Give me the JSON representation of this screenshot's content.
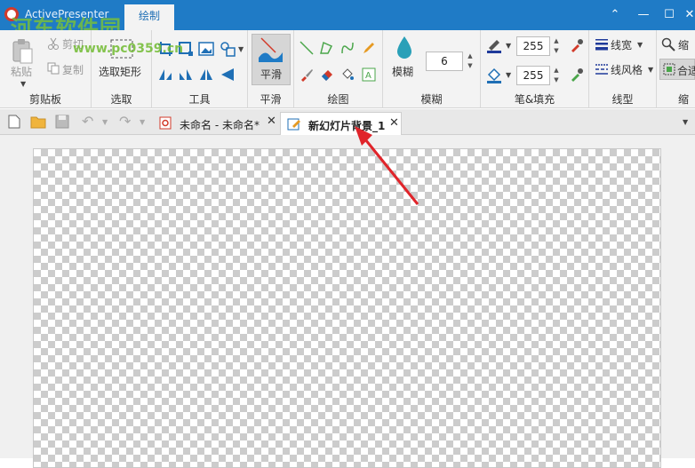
{
  "window": {
    "app_title": "ActivePresenter",
    "active_ribbon_tab": "绘制",
    "watermark_main": "河东软件园",
    "watermark_sub": "www.pc0359.cn",
    "controls": {
      "ribbon_toggle": "⌃",
      "minimize": "—",
      "maximize": "☐",
      "close": "✕"
    }
  },
  "ribbon": {
    "clipboard": {
      "label": "剪贴板",
      "paste": "粘贴",
      "cut": "剪切",
      "copy": "复制"
    },
    "select": {
      "label": "选取",
      "select_rect": "选取矩形"
    },
    "tools": {
      "label": "工具"
    },
    "smooth": {
      "label": "平滑",
      "smooth_button": "平滑"
    },
    "draw": {
      "label": "绘图"
    },
    "blur": {
      "label": "模糊",
      "blur_button": "模糊",
      "blur_value": "6"
    },
    "pen_fill": {
      "label": "笔&填充",
      "pen_value": "255",
      "fill_value": "255"
    },
    "line_type": {
      "label": "线型",
      "line_width": "线宽",
      "line_style": "线风格"
    },
    "zoom": {
      "label": "缩",
      "zoom_button": "缩",
      "fit_button": "合适"
    }
  },
  "doc_tabs": [
    {
      "label": "未命名 - 未命名*",
      "active": false
    },
    {
      "label": "新幻灯片背景_1",
      "active": true
    }
  ],
  "colors": {
    "title_bar": "#1f7bc6",
    "accent_red": "#d23a2a",
    "ribbon_bg": "#f3f3f3"
  }
}
